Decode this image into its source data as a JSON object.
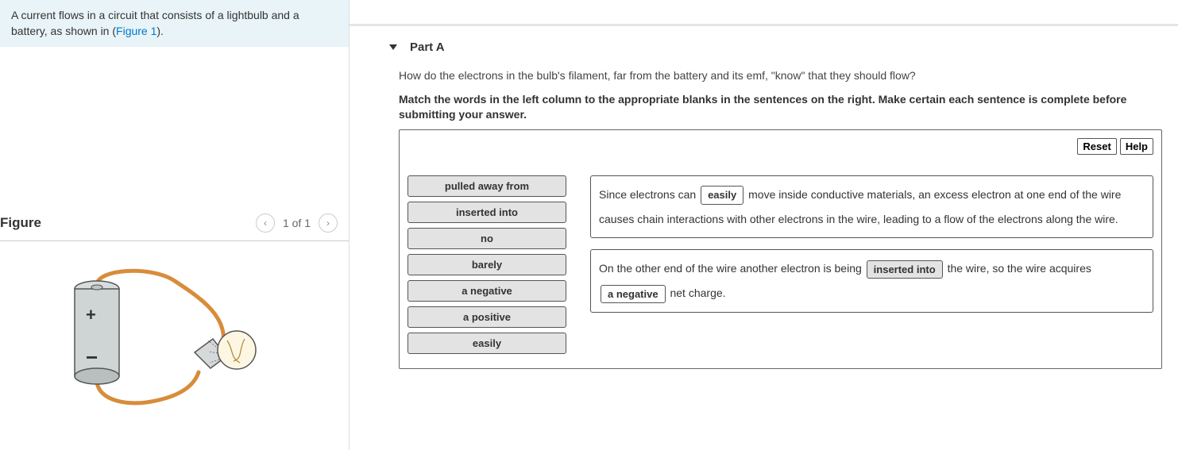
{
  "prompt": {
    "text_before_link": "A current flows in a circuit that consists of a lightbulb and a battery, as shown in (",
    "link_text": "Figure 1",
    "text_after_link": ")."
  },
  "figure": {
    "title": "Figure",
    "counter": "1 of 1"
  },
  "part": {
    "label": "Part A",
    "question": "How do the electrons in the bulb's filament, far from the battery and its emf, \"know\" that they should flow?",
    "instructions": "Match the words in the left column to the appropriate blanks in the sentences on the right. Make certain each sentence is complete before submitting your answer."
  },
  "toolbar": {
    "reset": "Reset",
    "help": "Help"
  },
  "word_bank": [
    "pulled away from",
    "inserted into",
    "no",
    "barely",
    "a negative",
    "a positive",
    "easily"
  ],
  "sentences": {
    "s1": {
      "t1": "Since electrons can ",
      "blank1": "easily",
      "t2": " move inside conductive materials, an excess electron at one end of the wire causes chain interactions with other electrons in the wire, leading to a flow of the electrons along the wire."
    },
    "s2": {
      "t1": "On the other end of the wire another electron is being ",
      "blank1": "inserted into",
      "t2": " the wire, so the wire acquires ",
      "blank2": "a negative",
      "t3": " net charge."
    }
  }
}
